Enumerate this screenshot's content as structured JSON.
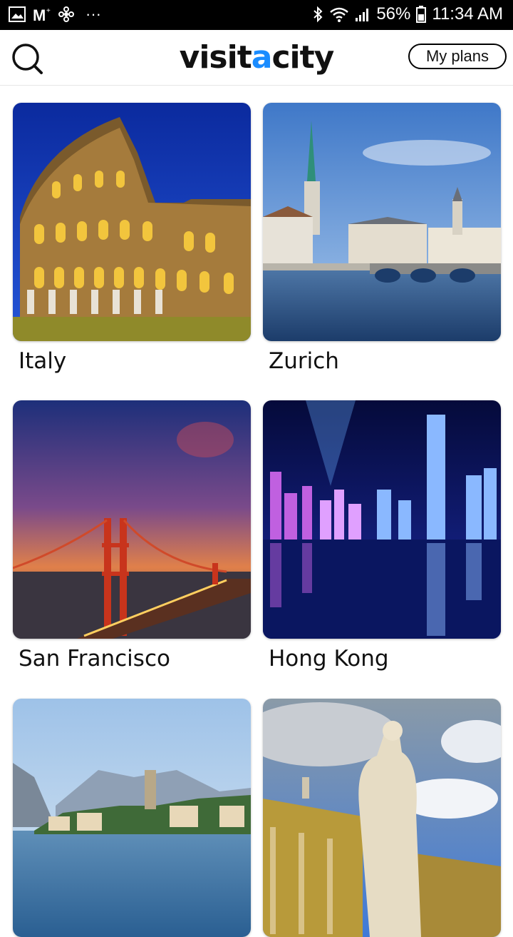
{
  "status_bar": {
    "battery": "56%",
    "time": "11:34 AM",
    "notification_dots": "···"
  },
  "header": {
    "logo_part1": "visit",
    "logo_accent": "a",
    "logo_part2": "city",
    "my_plans_label": "My plans"
  },
  "destinations": [
    {
      "name": "Italy"
    },
    {
      "name": "Zurich"
    },
    {
      "name": "San Francisco"
    },
    {
      "name": "Hong Kong"
    },
    {
      "name": ""
    },
    {
      "name": ""
    }
  ],
  "colors": {
    "accent": "#1a8cff",
    "status_bar_bg": "#000000",
    "text": "#111111"
  }
}
